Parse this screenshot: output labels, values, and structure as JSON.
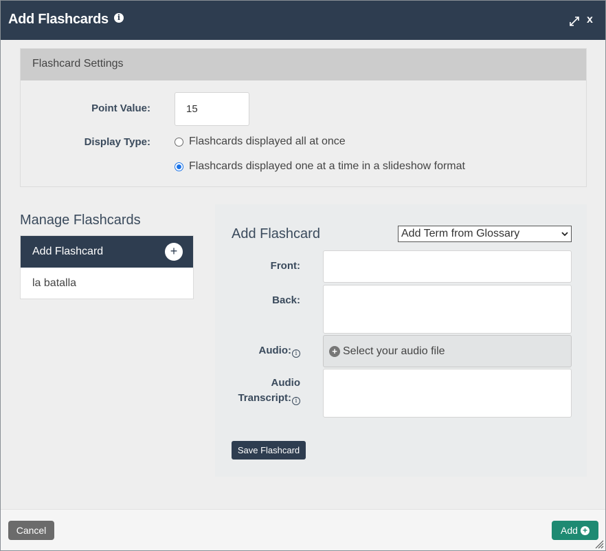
{
  "titlebar": {
    "title": "Add Flashcards",
    "info_icon": "info-icon",
    "expand_icon": "expand-icon",
    "close_label": "x"
  },
  "settings": {
    "header": "Flashcard Settings",
    "point_value_label": "Point Value:",
    "point_value": "15",
    "display_type_label": "Display Type:",
    "display_options": [
      {
        "label": "Flashcards displayed all at once",
        "selected": false
      },
      {
        "label": "Flashcards displayed one at a time in a slideshow format",
        "selected": true
      }
    ]
  },
  "manage": {
    "title": "Manage Flashcards",
    "header": "Add Flashcard",
    "add_icon": "plus-icon",
    "items": [
      "la batalla"
    ]
  },
  "editor": {
    "title": "Add Flashcard",
    "glossary_select": "Add Term from Glossary",
    "front_label": "Front:",
    "back_label": "Back:",
    "audio_label": "Audio:",
    "audio_placeholder": "Select your audio file",
    "transcript_label_1": "Audio",
    "transcript_label_2": "Transcript:",
    "save_label": "Save Flashcard"
  },
  "footer": {
    "cancel_label": "Cancel",
    "add_label": "Add"
  },
  "colors": {
    "header": "#2e3d50",
    "add_button": "#1e8a72",
    "cancel_button": "#6b6b6b",
    "radio_selected": "#1a73e8"
  }
}
